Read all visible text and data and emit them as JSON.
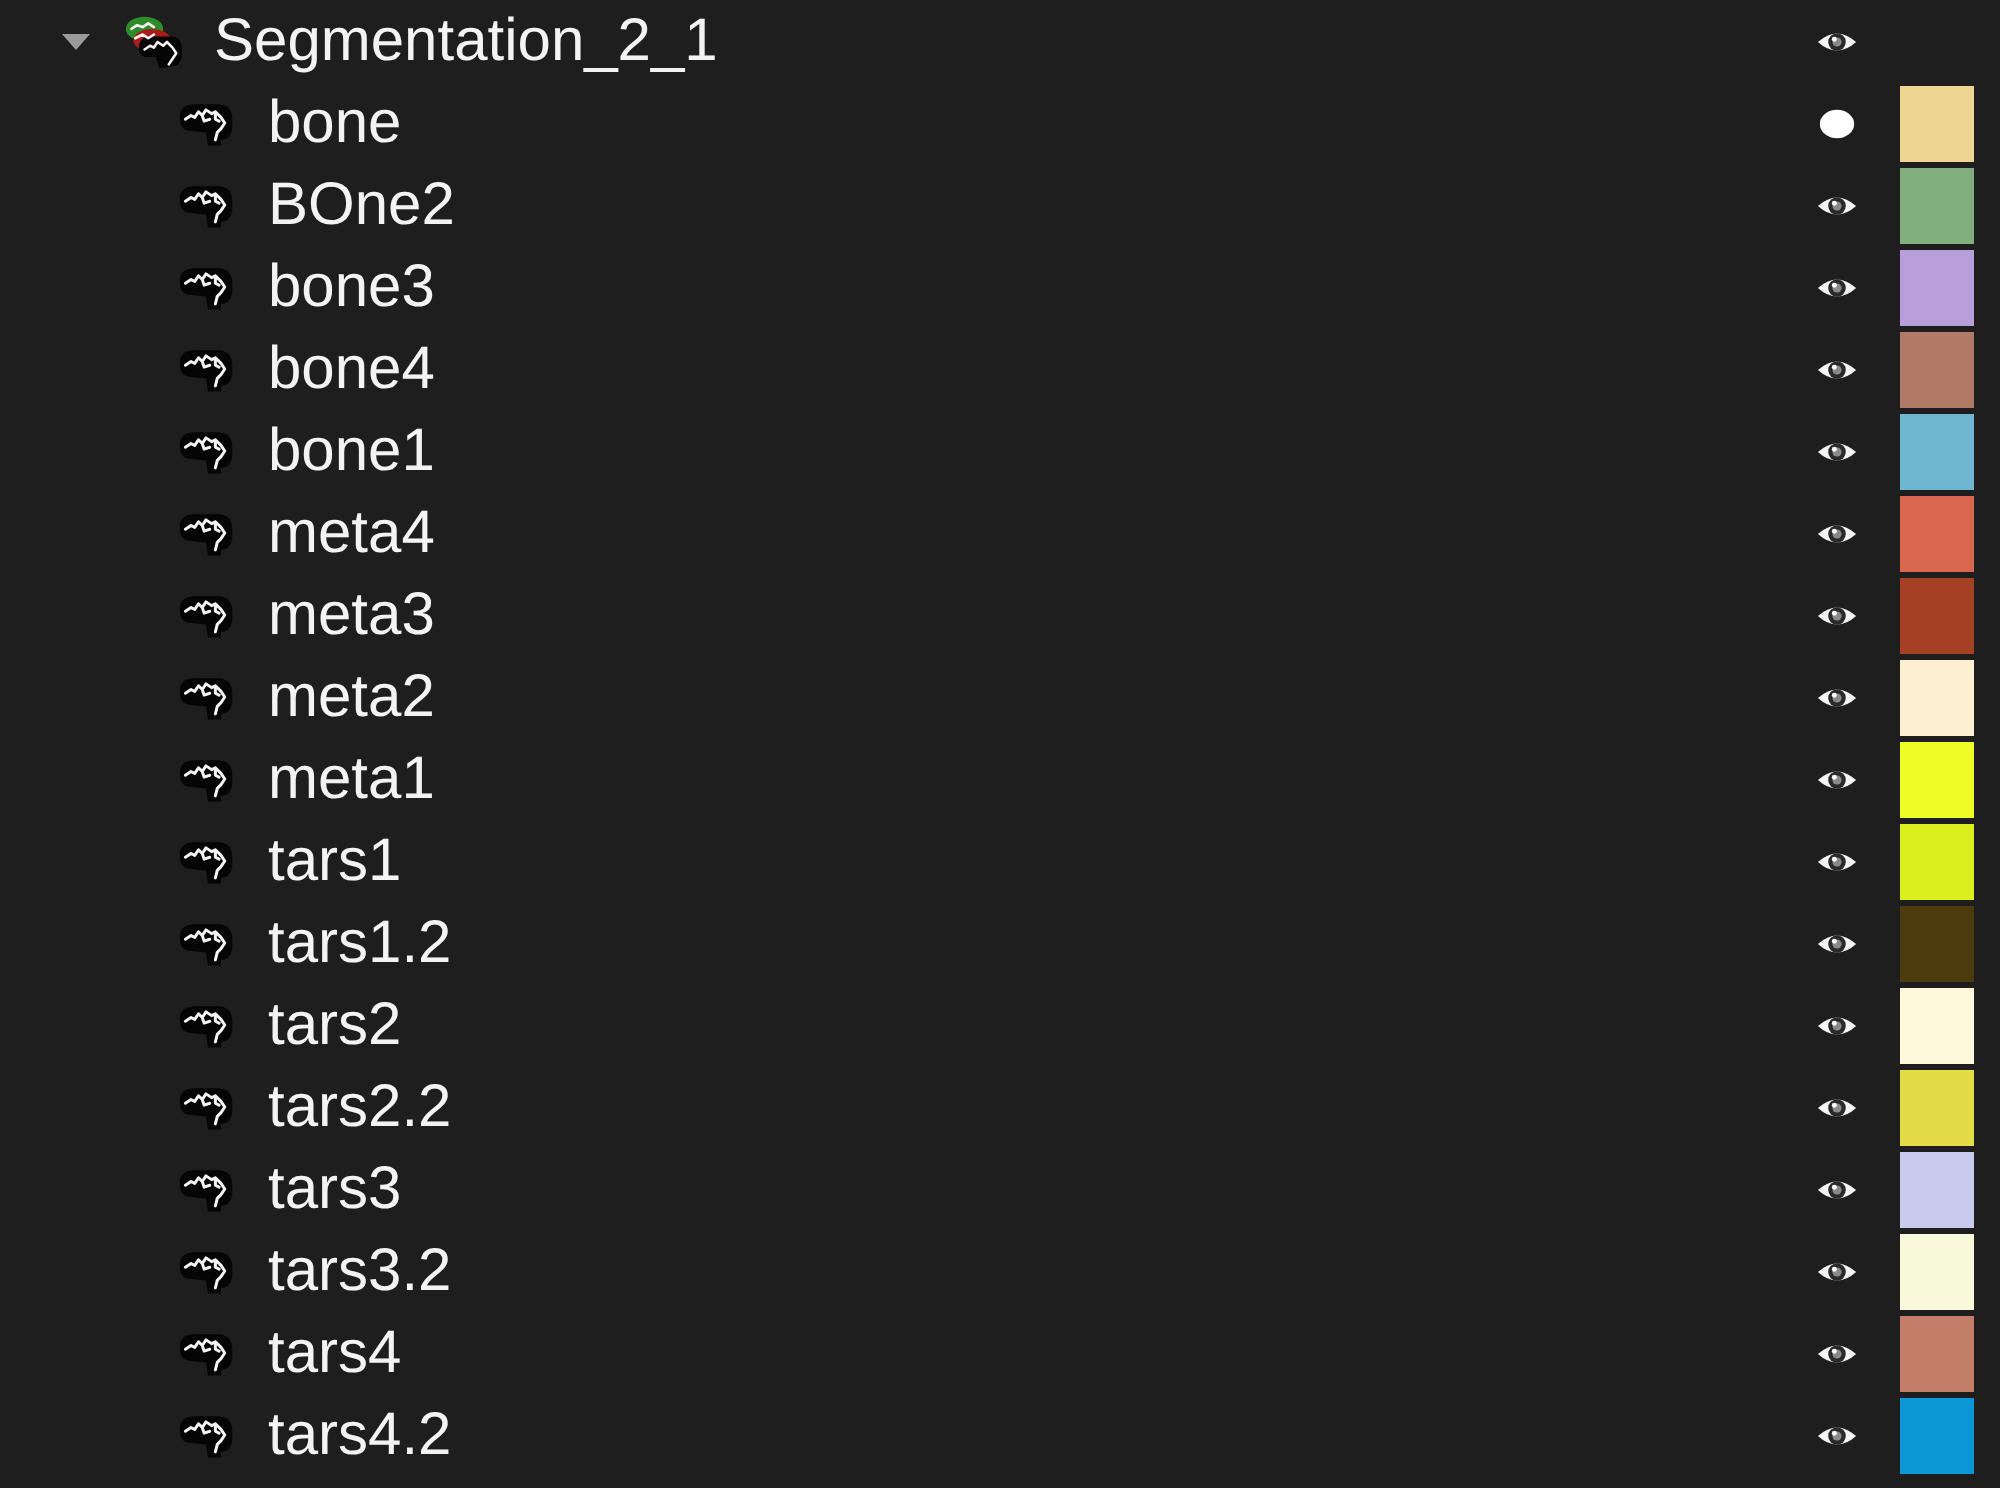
{
  "tree": [
    {
      "label": "Segmentation_2_1",
      "expanded": true,
      "eye_pressed": false,
      "children": [
        {
          "label": "bone",
          "color": "#efd592",
          "eye_pressed": true
        },
        {
          "label": "BOne2",
          "color": "#80ae7d",
          "eye_pressed": false
        },
        {
          "label": "bone3",
          "color": "#b89fdb",
          "eye_pressed": false
        },
        {
          "label": "bone4",
          "color": "#b07a66",
          "eye_pressed": false
        },
        {
          "label": "bone1",
          "color": "#6fb7d1",
          "eye_pressed": false
        },
        {
          "label": "meta4",
          "color": "#d9674e",
          "eye_pressed": false
        },
        {
          "label": "meta3",
          "color": "#a54024",
          "eye_pressed": false
        },
        {
          "label": "meta2",
          "color": "#fdf0d0",
          "eye_pressed": false
        },
        {
          "label": "meta1",
          "color": "#eefd26",
          "eye_pressed": false
        },
        {
          "label": "tars1",
          "color": "#dcef1e",
          "eye_pressed": false
        },
        {
          "label": "tars1.2",
          "color": "#4c3b0c",
          "eye_pressed": false
        },
        {
          "label": "tars2",
          "color": "#fff8dd",
          "eye_pressed": false
        },
        {
          "label": "tars2.2",
          "color": "#e4dc45",
          "eye_pressed": false
        },
        {
          "label": "tars3",
          "color": "#c9cbee",
          "eye_pressed": false
        },
        {
          "label": "tars3.2",
          "color": "#f8f8da",
          "eye_pressed": false
        },
        {
          "label": "tars4",
          "color": "#c47f69",
          "eye_pressed": false
        },
        {
          "label": "tars4.2",
          "color": "#0c97d6",
          "eye_pressed": false
        }
      ]
    }
  ]
}
